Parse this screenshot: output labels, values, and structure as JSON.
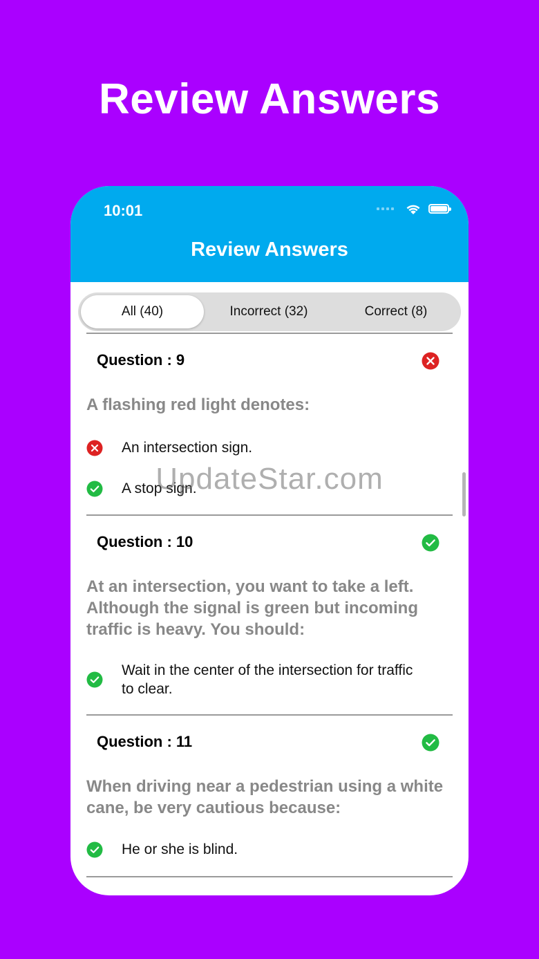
{
  "promo": {
    "title": "Review Answers"
  },
  "status_bar": {
    "time": "10:01"
  },
  "app": {
    "title": "Review Answers"
  },
  "tabs": [
    {
      "label": "All (40)",
      "active": true
    },
    {
      "label": "Incorrect (32)",
      "active": false
    },
    {
      "label": "Correct (8)",
      "active": false
    }
  ],
  "questions": [
    {
      "title": "Question : 9",
      "status": "incorrect",
      "text": "A flashing red light denotes:",
      "answers": [
        {
          "text": "An intersection sign.",
          "status": "incorrect"
        },
        {
          "text": "A stop sign.",
          "status": "correct"
        }
      ]
    },
    {
      "title": "Question : 10",
      "status": "correct",
      "text": "At an intersection, you want to take a left. Although the signal is green but incoming traffic is heavy. You should:",
      "answers": [
        {
          "text": "Wait in the center of the intersection for traffic to clear.",
          "status": "correct"
        }
      ]
    },
    {
      "title": "Question : 11",
      "status": "correct",
      "text": "When driving near a pedestrian using a white cane, be very cautious because:",
      "answers": [
        {
          "text": "He or she is blind.",
          "status": "correct"
        }
      ]
    }
  ],
  "watermark": "UpdateStar.com",
  "colors": {
    "background": "#aa00ff",
    "header": "#00aaee",
    "correct": "#22bb44",
    "incorrect": "#dd2222"
  },
  "icons": {
    "incorrect": "x-circle-icon",
    "correct": "check-circle-icon",
    "wifi": "wifi-icon",
    "battery": "battery-icon"
  }
}
